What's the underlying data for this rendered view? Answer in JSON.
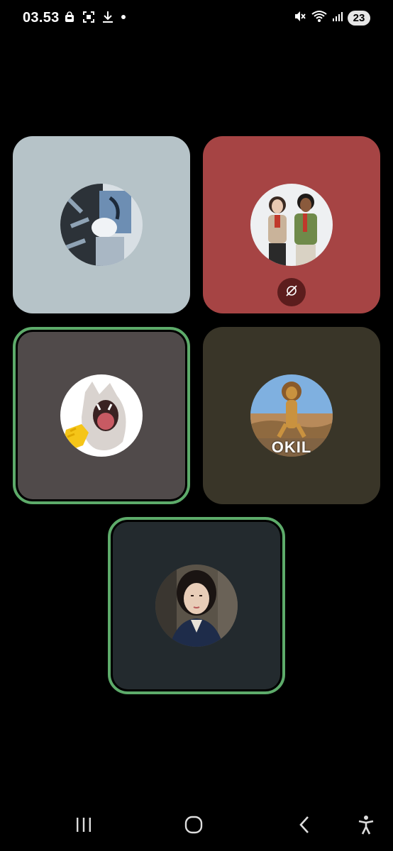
{
  "status_bar": {
    "time": "03.53",
    "battery": "23",
    "left_icons": [
      "shopping-bag-icon",
      "screenshot-icon",
      "download-icon",
      "dot-icon"
    ],
    "right_icons": [
      "mute-icon",
      "wifi-icon",
      "signal-icon"
    ]
  },
  "call": {
    "participants": [
      {
        "avatar": "avatar-graffiti",
        "speaking": false,
        "video_off_badge": false,
        "tile_color": "#b6c3c8"
      },
      {
        "avatar": "avatar-couple",
        "speaking": false,
        "video_off_badge": true,
        "tile_color": "#a64444"
      },
      {
        "avatar": "avatar-cat",
        "speaking": true,
        "video_off_badge": false,
        "tile_color": "#504a4a"
      },
      {
        "avatar": "avatar-lion",
        "speaking": false,
        "video_off_badge": false,
        "tile_color": "#393528",
        "avatar_text": "OKIL"
      },
      {
        "avatar": "avatar-woman",
        "speaking": true,
        "video_off_badge": false,
        "tile_color": "#232a2e"
      }
    ]
  },
  "nav_bar": {
    "buttons": [
      "recents-icon",
      "home-icon",
      "back-icon",
      "accessibility-icon"
    ]
  },
  "colors": {
    "speaking_border": "#5dab6a",
    "background": "#000000"
  }
}
